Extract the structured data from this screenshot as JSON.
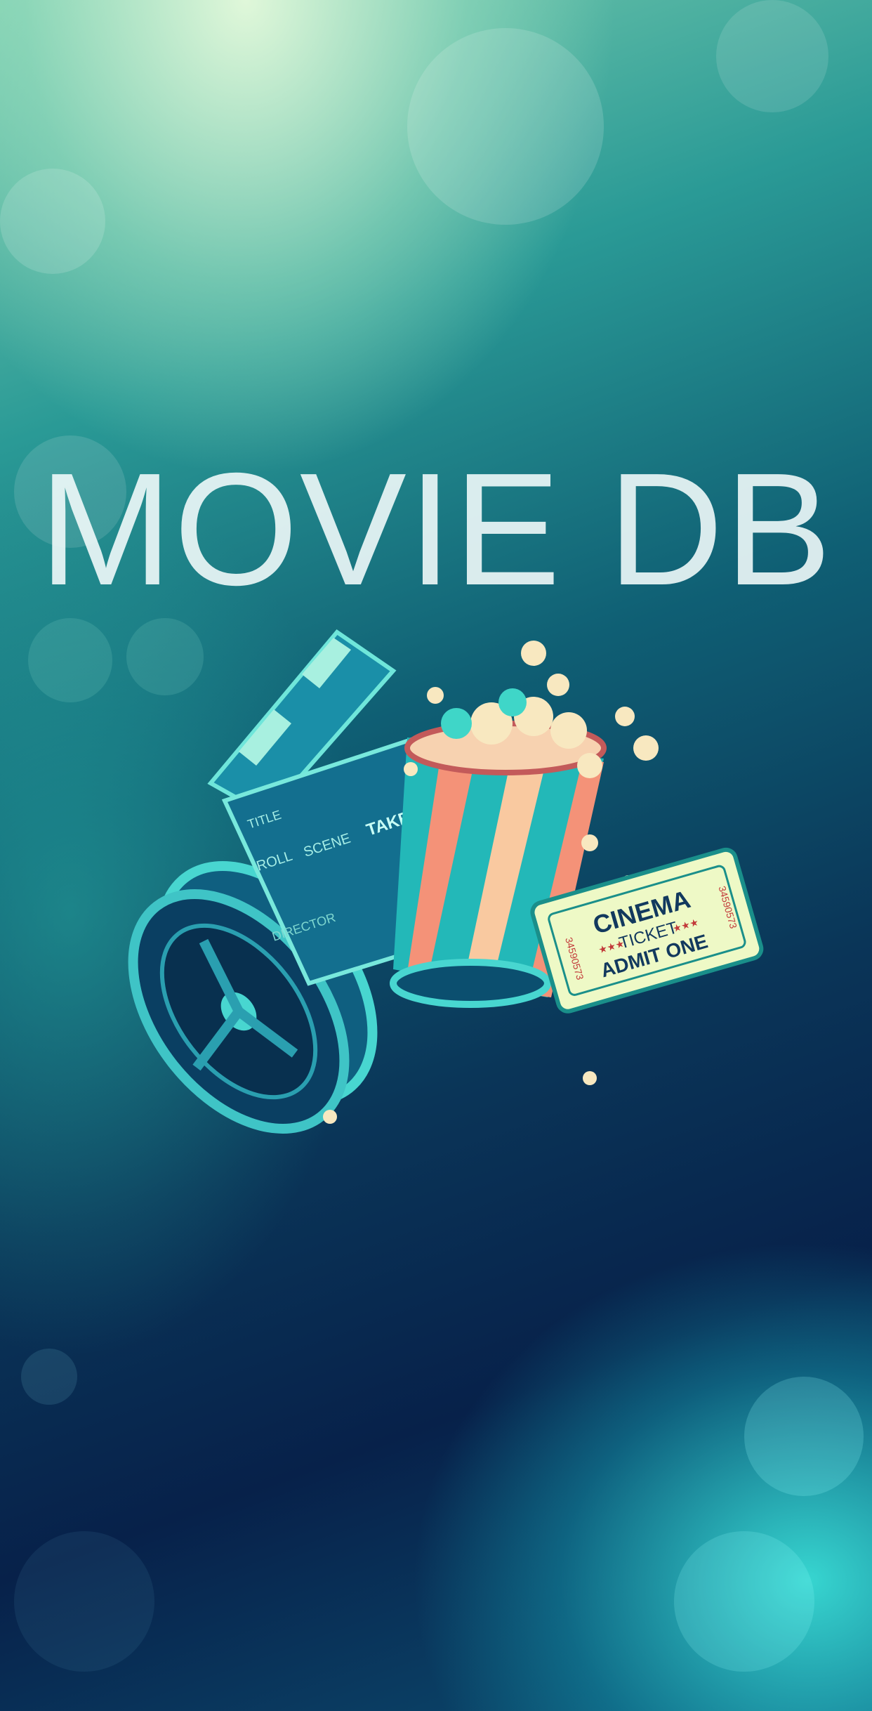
{
  "app": {
    "title": "MOVIE DB"
  },
  "illustration": {
    "clapperboard": {
      "title": "TITLE",
      "roll": "ROLL",
      "scene": "SCENE",
      "take": "TAKE",
      "director": "DIRECTOR"
    },
    "ticket": {
      "line1": "CINEMA",
      "line2": "TICKET",
      "line3": "ADMIT ONE",
      "serial": "34590573",
      "stars": "★★★"
    }
  },
  "colors": {
    "accent": "#3fd6c8",
    "dark_bg": "#07214a",
    "title_text": "#eef8f8"
  }
}
